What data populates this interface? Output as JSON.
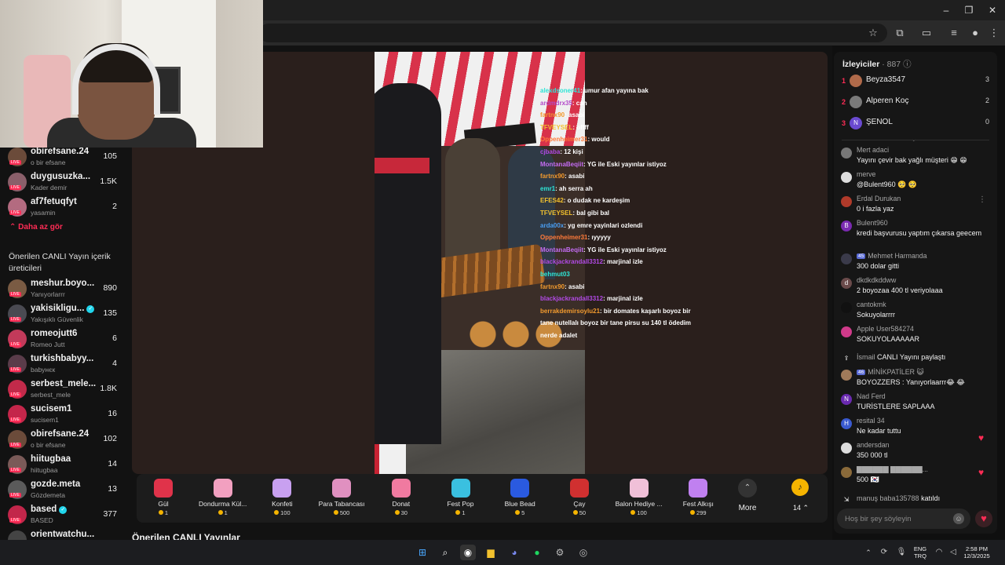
{
  "browser": {
    "window_controls": [
      "–",
      "❐",
      "✕"
    ]
  },
  "sidebar": {
    "followed": [
      {
        "name": "obirefsane.24",
        "sub": "o bir efsane",
        "count": "105",
        "color": "#6b4b3a"
      },
      {
        "name": "duygusuzka...",
        "sub": "Kader demir",
        "count": "1.5K",
        "color": "#8a5f6a"
      },
      {
        "name": "af7fetuqfyt",
        "sub": "yasamin",
        "count": "2",
        "color": "#b36b80"
      }
    ],
    "less_label": "Daha az gör",
    "recommended_heading": "Önerilen CANLI Yayın içerik üreticileri",
    "recommended": [
      {
        "name": "meshur.boyo...",
        "sub": "Yanıyorlarrr",
        "count": "890",
        "color": "#7a5b43",
        "verified": false
      },
      {
        "name": "yakisikligu...",
        "sub": "Yakışıklı Güvenlik",
        "count": "135",
        "color": "#4a4a52",
        "verified": true
      },
      {
        "name": "romeojutt6",
        "sub": "Romeo Jutt",
        "count": "6",
        "color": "#c23a5a",
        "verified": false
      },
      {
        "name": "turkishbabyy...",
        "sub": "babyнєк",
        "count": "4",
        "color": "#5a3c4a",
        "verified": false
      },
      {
        "name": "serbest_mele...",
        "sub": "serbest_mele",
        "count": "1.8K",
        "color": "#c22a4a",
        "verified": false
      },
      {
        "name": "sucisem1",
        "sub": "sucisem1",
        "count": "16",
        "color": "#c4264a",
        "verified": false
      },
      {
        "name": "obirefsane.24",
        "sub": "o bir efsane",
        "count": "102",
        "color": "#6b4b3a",
        "verified": false
      },
      {
        "name": "hiitugbaa",
        "sub": "hiitugbaa",
        "count": "14",
        "color": "#7a5a58",
        "verified": false
      },
      {
        "name": "gozde.meta",
        "sub": "Gözdemeta",
        "count": "13",
        "color": "#5a5a5a",
        "verified": false
      },
      {
        "name": "based",
        "sub": "BASED",
        "count": "377",
        "color": "#c2264a",
        "verified": true
      },
      {
        "name": "orientwatchu...",
        "sub": "",
        "count": "",
        "color": "#444",
        "verified": false
      }
    ]
  },
  "overlay_chat": [
    {
      "u": "alexdsoner41",
      "t": ": umur afan yayına bak",
      "c": "#2ee6d6"
    },
    {
      "u": "ardmdrx35",
      "t": ": can",
      "c": "#b34ac9"
    },
    {
      "u": "fartnx90",
      "t": ": asabi",
      "c": "#f29a2e"
    },
    {
      "u": "TFVEYSEL",
      "t": ": offff",
      "c": "#f2c12e"
    },
    {
      "u": "Oppenheimer31",
      "t": ": would",
      "c": "#ff7a3a"
    },
    {
      "u": "cjbaba",
      "t": ": 12 kişi",
      "c": "#b24ae6"
    },
    {
      "u": "MontanaBeqiit",
      "t": ": YG ile Eski yayınlar istiyoz",
      "c": "#c46cf2"
    },
    {
      "u": "fartnx90",
      "t": ": asabi",
      "c": "#f29a2e"
    },
    {
      "u": "emr1",
      "t": ": ah serra ah",
      "c": "#2ee6d6"
    },
    {
      "u": "EFES42",
      "t": ": o dudak ne kardeşim",
      "c": "#f2c12e"
    },
    {
      "u": "TFVEYSEL",
      "t": ": bal gibi bal",
      "c": "#f2c12e"
    },
    {
      "u": "arda00x",
      "t": ": yg emre yayinlari ozlendi",
      "c": "#4a9ef2"
    },
    {
      "u": "Oppenheimer31",
      "t": ": ıyyyyy",
      "c": "#ff7a3a"
    },
    {
      "u": "MontanaBeqiit",
      "t": ": YG ile Eski yayınlar istiyoz",
      "c": "#c46cf2"
    },
    {
      "u": "blackjackrandall3312",
      "t": ": marjinal izle",
      "c": "#b24ae6"
    },
    {
      "u": "behmut03",
      "t": "",
      "c": "#2ee6d6"
    },
    {
      "u": "fartnx90",
      "t": ": asabi",
      "c": "#f29a2e"
    },
    {
      "u": "blackjackrandall3312",
      "t": ": marjinal izle",
      "c": "#b24ae6"
    },
    {
      "u": "berrakdemirsoylu21",
      "t": ": bir domates kaşarlı boyoz bir tane nutellalı boyoz bir tane pirsu su 140 tl ödedim nerde adalet",
      "c": "#f29a2e"
    }
  ],
  "gifts": [
    {
      "name": "Gül",
      "price": "1",
      "color": "#e0334a"
    },
    {
      "name": "Dondurma Kül...",
      "price": "1",
      "color": "#f2a0c0"
    },
    {
      "name": "Konfeti",
      "price": "100",
      "color": "#c8a0f0"
    },
    {
      "name": "Para Tabancası",
      "price": "500",
      "color": "#e090c0"
    },
    {
      "name": "Donat",
      "price": "30",
      "color": "#f07aa0"
    },
    {
      "name": "Fest Pop",
      "price": "1",
      "color": "#3ac0e0"
    },
    {
      "name": "Blue Bead",
      "price": "5",
      "color": "#2a5ae0"
    },
    {
      "name": "Çay",
      "price": "50",
      "color": "#d03030"
    },
    {
      "name": "Balon Hediye ...",
      "price": "100",
      "color": "#f0c0d8"
    },
    {
      "name": "Fest Alkışı",
      "price": "299",
      "color": "#c080f0"
    }
  ],
  "gift_more_label": "More",
  "coins_value": "14",
  "recommended_streams_heading": "Önerilen CANLI Yayınlar",
  "viewers": {
    "title": "İzleyiciler",
    "count": "· 887",
    "ranking": [
      {
        "rank": "1",
        "name": "Beyza3547",
        "score": "3",
        "color": "#b06a4a"
      },
      {
        "rank": "2",
        "name": "Alperen Koç",
        "score": "2",
        "color": "#7a7a7a"
      },
      {
        "rank": "3",
        "name": "ŞENOL",
        "score": "0",
        "color": "#6a4ad0",
        "initial": "N"
      }
    ]
  },
  "chat": [
    {
      "user": "Mert adaci",
      "text": "Yayını çevir bak yağlı müşteri 😁 😁",
      "color": "#777"
    },
    {
      "user": "merve",
      "text": "@Bulent960 🥺 🥺",
      "color": "#ddd"
    },
    {
      "user": "Erdal Durukan",
      "text": "0 i fazla yaz",
      "color": "#b03a2a"
    },
    {
      "user": "Bulent960",
      "text": "kredi başvurusu yaptım çıkarsa geecem",
      "color": "#7a2ab0",
      "initial": "B"
    },
    {
      "user": "Mehmet Harmanda",
      "text": "300 dolar gitti",
      "color": "#3a3a4a",
      "level": "45"
    },
    {
      "user": "dkdkdkddww",
      "text": "2 boyozaa 400 tl veriyolaaa",
      "color": "#6a4a4a",
      "initial": "d"
    },
    {
      "user": "cantokmk",
      "text": "Sokuyolarrrr",
      "color": "#111"
    },
    {
      "user": "Apple User584274",
      "text": "SOKUYOLAAAAAR",
      "color": "#d03a8a"
    },
    {
      "user": "İsmail",
      "text": "CANLI Yayını paylaştı",
      "color": "#555"
    },
    {
      "user": "MİNİKPATİLER 😺",
      "text": "BOYOZZERS : Yanıyorlaarrr😂 😂",
      "color": "#a07a5a",
      "level": "46"
    },
    {
      "user": "Nad Ferd",
      "text": "TURİSTLERE SAPLAAA",
      "color": "#6a2ab0",
      "initial": "N"
    },
    {
      "user": "resital 34",
      "text": "Ne kadar tuttu",
      "color": "#3a5ad0",
      "initial": "H"
    },
    {
      "user": "andersdan",
      "text": "350 000 tl",
      "color": "#ddd"
    },
    {
      "user": "▇▇▇▇▇▇ ▇▇▇▇▇▇...",
      "text": "500 🇰🇷",
      "color": "#8a6a3a"
    },
    {
      "user": "manuş baba135788",
      "text": "katıldı",
      "color": "#555"
    }
  ],
  "chat_input": {
    "placeholder": "Hoş bir şey söyleyin"
  },
  "taskbar": {
    "lang_top": "ENG",
    "lang_bottom": "TRQ",
    "time": "2:58 PM",
    "date": "12/3/2025"
  }
}
